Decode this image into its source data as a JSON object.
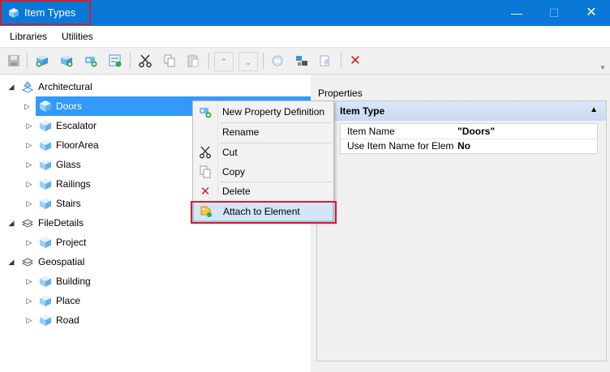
{
  "window": {
    "title": "Item Types",
    "app_icon": "cube-icon",
    "controls": [
      "minimize",
      "maximize",
      "close"
    ]
  },
  "menu": {
    "items": [
      {
        "label": "Libraries"
      },
      {
        "label": "Utilities"
      }
    ]
  },
  "toolbar": {
    "buttons": [
      "save-icon",
      "new-library-icon",
      "new-item-type-icon",
      "new-property-icon",
      "import-icon",
      "cut-icon",
      "copy-icon",
      "paste-icon",
      "move-up-icon",
      "move-down-icon",
      "attach-icon",
      "detach-icon",
      "copy-item-icon",
      "delete-icon"
    ]
  },
  "tree": {
    "libraries": [
      {
        "label": "Architectural",
        "expanded": true,
        "children": [
          {
            "label": "Doors",
            "selected": true
          },
          {
            "label": "Escalator"
          },
          {
            "label": "FloorArea"
          },
          {
            "label": "Glass"
          },
          {
            "label": "Railings"
          },
          {
            "label": "Stairs"
          }
        ]
      },
      {
        "label": "FileDetails",
        "expanded": true,
        "children": [
          {
            "label": "Project"
          }
        ]
      },
      {
        "label": "Geospatial",
        "expanded": true,
        "children": [
          {
            "label": "Building"
          },
          {
            "label": "Place"
          },
          {
            "label": "Road"
          }
        ]
      }
    ]
  },
  "properties": {
    "label": "Properties",
    "section_title": "Item Type",
    "rows": [
      {
        "name": "Item Name",
        "value": "\"Doors\""
      },
      {
        "name": "Use Item Name for Element",
        "value": "No"
      }
    ]
  },
  "context_menu": {
    "items": [
      {
        "label": "New Property Definition",
        "icon": "new-property-icon"
      },
      {
        "label": "Rename",
        "icon": ""
      },
      {
        "label": "Cut",
        "icon": "cut-icon"
      },
      {
        "label": "Copy",
        "icon": "copy-icon"
      },
      {
        "label": "Delete",
        "icon": "delete-icon"
      },
      {
        "label": "Attach to Element",
        "icon": "attach-tag-icon",
        "hovered": true
      }
    ]
  },
  "colors": {
    "titlebar": "#0a78d7",
    "selection": "#3399ff",
    "highlight_box": "#d0202e",
    "delete_red": "#d61f26"
  }
}
